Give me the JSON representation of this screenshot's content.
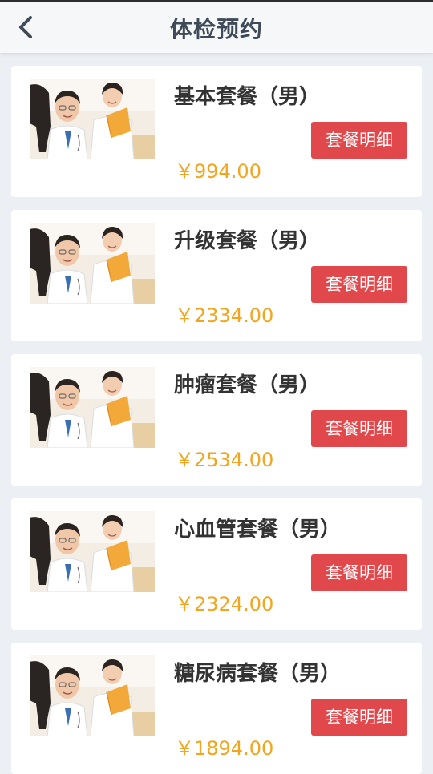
{
  "header": {
    "title": "体检预约",
    "back_icon": "chevron-left-icon"
  },
  "packages": [
    {
      "name": "基本套餐（男）",
      "price": "￥994.00",
      "button_label": "套餐明细"
    },
    {
      "name": "升级套餐（男）",
      "price": "￥2334.00",
      "button_label": "套餐明细"
    },
    {
      "name": "肿瘤套餐（男）",
      "price": "￥2534.00",
      "button_label": "套餐明细"
    },
    {
      "name": "心血管套餐（男）",
      "price": "￥2324.00",
      "button_label": "套餐明细"
    },
    {
      "name": "糖尿病套餐（男）",
      "price": "￥1894.00",
      "button_label": "套餐明细"
    }
  ],
  "colors": {
    "button": "#e0484c",
    "price": "#f2a51f",
    "background": "#eceff3",
    "title": "#3e4a57"
  }
}
